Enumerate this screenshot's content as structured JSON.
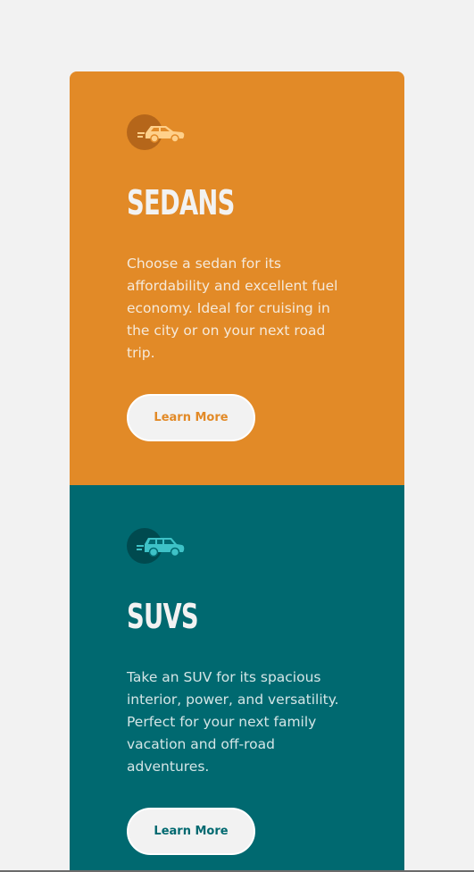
{
  "cards": [
    {
      "id": "sedans",
      "icon": "sedan-icon",
      "title": "SEDANS",
      "description": "Choose a sedan for its affordability and excellent fuel economy. Ideal for cruising in the city or on your next road trip.",
      "button_label": "Learn More",
      "background_color": "#e28a27"
    },
    {
      "id": "suvs",
      "icon": "suv-icon",
      "title": "SUVS",
      "description": "Take an SUV for its spacious interior, power, and versatility. Perfect for your next family vacation and off-road adventures.",
      "button_label": "Learn More",
      "background_color": "#006970"
    }
  ],
  "colors": {
    "page_background": "#f2f2f2",
    "sedan_orange": "#e28a27",
    "suv_teal": "#006970",
    "light_text": "#f2f2f2"
  }
}
